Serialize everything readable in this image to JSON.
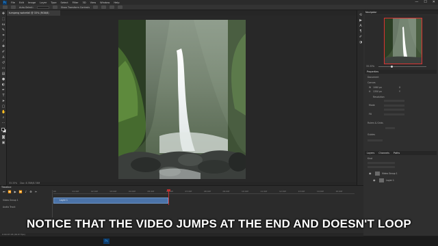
{
  "app": {
    "logo": "Ps",
    "menu": [
      "File",
      "Edit",
      "Image",
      "Layer",
      "Type",
      "Select",
      "Filter",
      "3D",
      "View",
      "Window",
      "Help"
    ],
    "window_controls": [
      "—",
      "☐",
      "✕"
    ]
  },
  "options_bar": {
    "labels": [
      "Auto-Select:",
      "Layer",
      "Show Transform Controls"
    ]
  },
  "document": {
    "tab_title": "tumpeng waterfall @ 33% (RGB/8)"
  },
  "status_bar": {
    "zoom": "33.33%",
    "doc_info": "Doc: 8.78M/8.78M"
  },
  "navigator": {
    "tab": "Navigator",
    "zoom": "33.33%",
    "zoom_fraction": 0.28
  },
  "properties": {
    "tab": "Properties",
    "section_doc": "Document",
    "section_canvas": "Canvas",
    "w_label": "W",
    "h_label": "H",
    "w_value": "1080 px",
    "h_value": "1350 px",
    "x_label": "X",
    "y_label": "Y",
    "resolution_label": "Resolution",
    "mode_label": "Mode",
    "fill_label": "Fill",
    "section_rulers": "Rulers & Grids",
    "section_guides": "Guides"
  },
  "layers": {
    "tabs": [
      "Layers",
      "Channels",
      "Paths"
    ],
    "search_label": "Kind",
    "items": [
      {
        "name": "Video Group 1"
      },
      {
        "name": "Layer 1"
      }
    ]
  },
  "timeline": {
    "tab": "Timeline",
    "track_labels": [
      "Video Group 1",
      "Audio Track"
    ],
    "ruler_ticks": [
      "00",
      "01:00f",
      "02:00f",
      "03:00f",
      "04:00f",
      "05:00f",
      "06:00f",
      "07:00f",
      "08:00f",
      "09:00f",
      "10:00f",
      "11:00f",
      "12:00f",
      "13:00f",
      "14:00f",
      "15:00f"
    ],
    "clip_name": "Layer 1",
    "footer": "0:00:07:03 (29.97 fps)"
  },
  "caption": "NOTICE THAT THE VIDEO JUMPS AT THE END AND DOESN'T LOOP",
  "taskbar": {
    "ps_label": "Ps"
  },
  "colors": {
    "accent": "#4b73a8",
    "playhead": "#c03030"
  }
}
